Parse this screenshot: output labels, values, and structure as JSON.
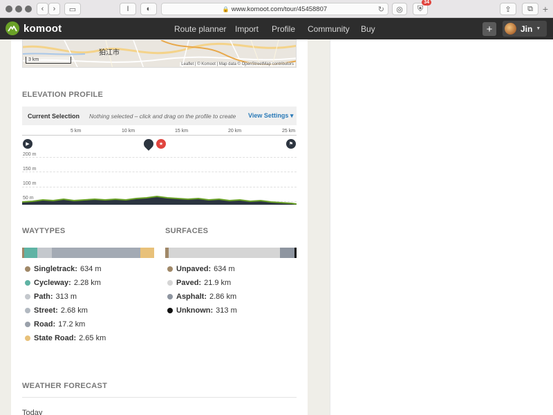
{
  "browser": {
    "url": "www.komoot.com/tour/45458807",
    "extension_badge": "34"
  },
  "nav": {
    "brand": "komoot",
    "links": [
      "Route planner",
      "Import",
      "Profile",
      "Community",
      "Buy"
    ],
    "add_icon": "+",
    "user_name": "Jin"
  },
  "map": {
    "place_label": "狛江市",
    "scale_label": "3 km",
    "attribution": "Leaflet | © Komoot | Map data © OpenStreetMap contributors"
  },
  "elevation": {
    "title": "ELEVATION PROFILE",
    "selection_label": "Current Selection",
    "selection_text": "Nothing selected – click and drag on the profile to create",
    "view_settings": "View Settings",
    "km_ticks": [
      "5 km",
      "10 km",
      "15 km",
      "20 km",
      "25 km"
    ],
    "y_labels": [
      "200 m",
      "150 m",
      "100 m",
      "50 m"
    ]
  },
  "waytypes": {
    "title": "WAYTYPES",
    "segments": [
      {
        "color": "#a08868",
        "pct": 1.5
      },
      {
        "color": "#5fb3a4",
        "pct": 10
      },
      {
        "color": "#c4c8cd",
        "pct": 11
      },
      {
        "color": "#a3aab4",
        "pct": 67
      },
      {
        "color": "#e8c17a",
        "pct": 10.5
      }
    ],
    "items": [
      {
        "name": "Singletrack:",
        "value": "634 m",
        "color": "#a08868"
      },
      {
        "name": "Cycleway:",
        "value": "2.28 km",
        "color": "#5fb3a4"
      },
      {
        "name": "Path:",
        "value": "313 m",
        "color": "#c4c8cd"
      },
      {
        "name": "Street:",
        "value": "2.68 km",
        "color": "#b2b9c1"
      },
      {
        "name": "Road:",
        "value": "17.2 km",
        "color": "#9aa1ab"
      },
      {
        "name": "State Road:",
        "value": "2.65 km",
        "color": "#e8c17a"
      }
    ]
  },
  "surfaces": {
    "title": "SURFACES",
    "segments": [
      {
        "color": "#a08868",
        "pct": 2.5
      },
      {
        "color": "#d5d5d5",
        "pct": 85
      },
      {
        "color": "#8e95a0",
        "pct": 11
      },
      {
        "color": "#111111",
        "pct": 1.5
      }
    ],
    "items": [
      {
        "name": "Unpaved:",
        "value": "634 m",
        "color": "#a08868"
      },
      {
        "name": "Paved:",
        "value": "21.9 km",
        "color": "#d5d5d5"
      },
      {
        "name": "Asphalt:",
        "value": "2.86 km",
        "color": "#8e95a0"
      },
      {
        "name": "Unknown:",
        "value": "313 m",
        "color": "#111111"
      }
    ]
  },
  "weather": {
    "title": "WEATHER FORECAST",
    "today": "Today"
  }
}
